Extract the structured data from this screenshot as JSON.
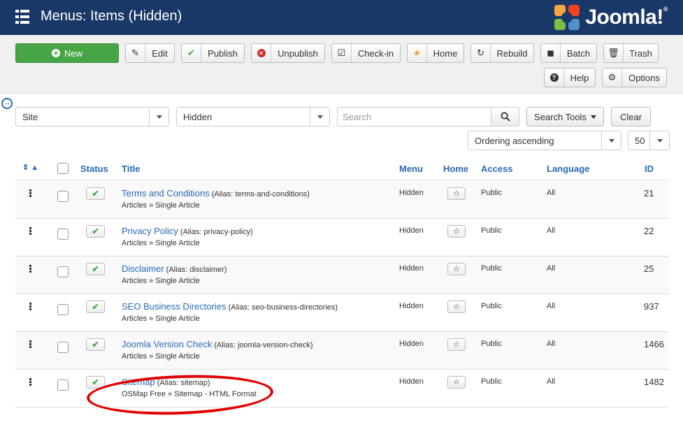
{
  "header": {
    "title": "Menus: Items (Hidden)",
    "brand": "Joomla!",
    "menu_icon": "grid-icon"
  },
  "toolbar": {
    "buttons": [
      {
        "label": "New",
        "icon": "plus-circle-icon"
      },
      {
        "label": "Edit",
        "icon": "edit-icon"
      },
      {
        "label": "Publish",
        "icon": "check-icon"
      },
      {
        "label": "Unpublish",
        "icon": "times-circle-icon"
      },
      {
        "label": "Check-in",
        "icon": "checkbox-icon"
      },
      {
        "label": "Home",
        "icon": "star-icon"
      },
      {
        "label": "Rebuild",
        "icon": "refresh-icon"
      },
      {
        "label": "Batch",
        "icon": "square-icon"
      },
      {
        "label": "Trash",
        "icon": "trash-icon"
      },
      {
        "label": "Help",
        "icon": "question-icon"
      },
      {
        "label": "Options",
        "icon": "gear-icon"
      }
    ]
  },
  "filters": {
    "site": "Site",
    "menu": "Hidden",
    "search_placeholder": "Search",
    "search_tools": "Search Tools",
    "clear": "Clear",
    "ordering": "Ordering ascending",
    "limit": "50"
  },
  "table": {
    "headers": {
      "status": "Status",
      "title": "Title",
      "menu": "Menu",
      "home": "Home",
      "access": "Access",
      "language": "Language",
      "id": "ID"
    },
    "rows": [
      {
        "title": "Terms and Conditions",
        "alias": "(Alias: terms-and-conditions)",
        "type": "Articles » Single Article",
        "menu": "Hidden",
        "access": "Public",
        "language": "All",
        "id": "21"
      },
      {
        "title": "Privacy Policy",
        "alias": "(Alias: privacy-policy)",
        "type": "Articles » Single Article",
        "menu": "Hidden",
        "access": "Public",
        "language": "All",
        "id": "22"
      },
      {
        "title": "Disclaimer",
        "alias": "(Alias: disclaimer)",
        "type": "Articles » Single Article",
        "menu": "Hidden",
        "access": "Public",
        "language": "All",
        "id": "25"
      },
      {
        "title": "SEO Business Directories",
        "alias": "(Alias: seo-business-directories)",
        "type": "Articles » Single Article",
        "menu": "Hidden",
        "access": "Public",
        "language": "All",
        "id": "937"
      },
      {
        "title": "Joomla Version Check",
        "alias": "(Alias: joomla-version-check)",
        "type": "Articles » Single Article",
        "menu": "Hidden",
        "access": "Public",
        "language": "All",
        "id": "1466"
      },
      {
        "title": "Sitemap",
        "alias": "(Alias: sitemap)",
        "type": "OSMap Free » Sitemap - HTML Format",
        "menu": "Hidden",
        "access": "Public",
        "language": "All",
        "id": "1482"
      }
    ]
  },
  "colors": {
    "header_bg": "#1a3867",
    "accent": "#2a69b8",
    "new_button": "#46a546",
    "highlight": "#e00000"
  }
}
